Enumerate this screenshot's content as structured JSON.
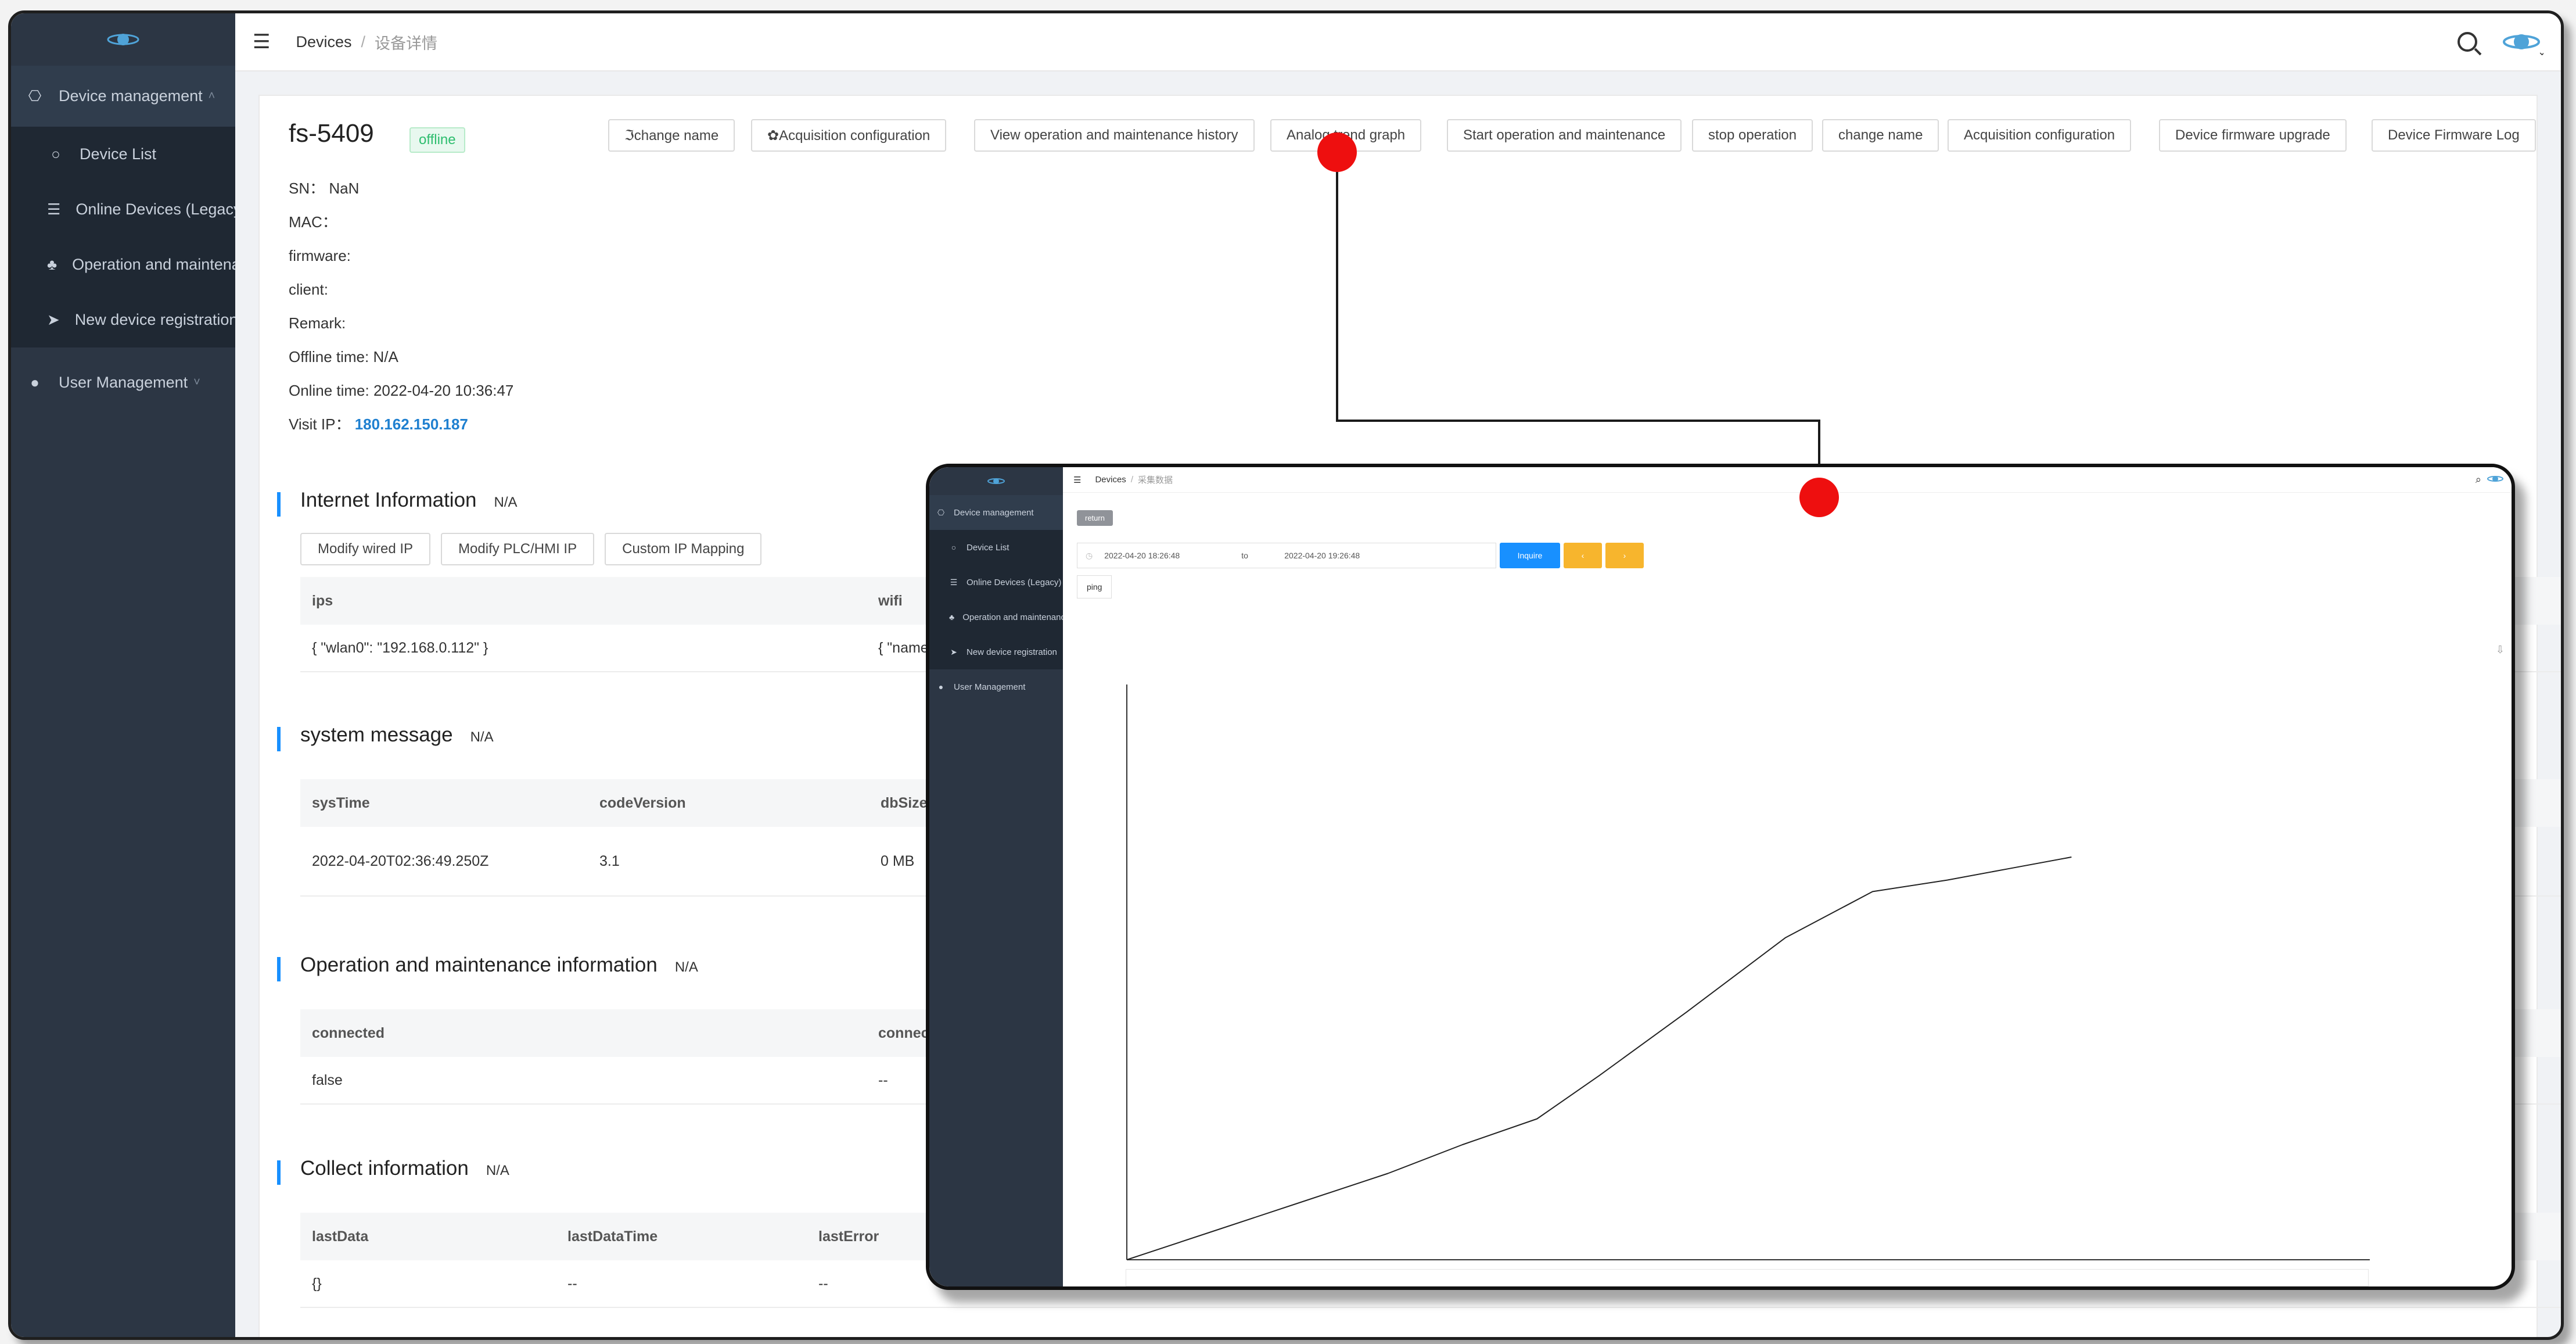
{
  "sidebar": {
    "group_label": "Device management",
    "items": [
      {
        "label": "Device List",
        "icon": "circle-icon"
      },
      {
        "label": "Online Devices (Legacy)",
        "icon": "list-icon"
      },
      {
        "label": "Operation and maintenance",
        "icon": "sitemap-icon"
      },
      {
        "label": "New device registration",
        "icon": "send-icon"
      }
    ],
    "user_label": "User Management"
  },
  "header": {
    "crumb_root": "Devices",
    "crumb_current": "设备详情"
  },
  "device": {
    "name": "fs-5409",
    "status": "offline",
    "sn": "SN：  NaN",
    "mac": "MAC：",
    "firmware": "firmware:",
    "client": "client:",
    "remark": "Remark:",
    "offline_time": "Offline time: N/A",
    "online_time": "Online time: 2022-04-20 10:36:47",
    "visit_ip_label": "Visit IP：",
    "visit_ip": "180.162.150.187"
  },
  "actions": [
    "ℑchange name",
    "✿Acquisition configuration",
    "View operation and maintenance history",
    "Analog trend graph",
    "Start operation and maintenance",
    "stop operation",
    "change name",
    "Acquisition configuration",
    "Device firmware upgrade",
    "Device Firmware Log"
  ],
  "internet": {
    "title": "Internet Information",
    "na": "N/A",
    "buttons": [
      "Modify wired IP",
      "Modify PLC/HMI IP",
      "Custom IP Mapping"
    ],
    "headers": [
      "ips",
      "wifi"
    ],
    "row": [
      "{ \"wlan0\": \"192.168.0.112\" }",
      "{ \"name\":"
    ]
  },
  "system": {
    "title": "system message",
    "na": "N/A",
    "headers": [
      "sysTime",
      "codeVersion",
      "dbSize"
    ],
    "row": [
      "2022-04-20T02:36:49.250Z",
      "3.1",
      "0 MB"
    ]
  },
  "ops": {
    "title": "Operation and maintenance information",
    "na": "N/A",
    "headers": [
      "connected",
      "connectT"
    ],
    "row": [
      "false",
      "--"
    ]
  },
  "collect": {
    "title": "Collect information",
    "na": "N/A",
    "headers": [
      "lastData",
      "lastDataTime",
      "lastError"
    ],
    "row": [
      "{}",
      "--",
      "--"
    ]
  },
  "inset": {
    "crumb_root": "Devices",
    "crumb_current": "采集数据",
    "return_label": "return",
    "start_time": "2022-04-20 18:26:48",
    "to_label": "to",
    "end_time": "2022-04-20 19:26:48",
    "inquire_label": "Inquire",
    "prev_label": "‹",
    "next_label": "›",
    "ping_label": "ping"
  },
  "chart_data": {
    "type": "line",
    "title": "",
    "xlabel": "",
    "ylabel": "",
    "series": [
      {
        "values": [
          0,
          0.05,
          0.1,
          0.15,
          0.2,
          0.245,
          0.32,
          0.43,
          0.56,
          0.64,
          0.66,
          0.68,
          0.7
        ]
      }
    ],
    "x": [
      0,
      0.07,
      0.14,
      0.21,
      0.27,
      0.33,
      0.38,
      0.45,
      0.53,
      0.6,
      0.66,
      0.71,
      0.76
    ],
    "grid": false
  },
  "colors": {
    "sidebar_bg": "#2c3644",
    "accent": "#1890ff",
    "annotation": "#ee0f0f",
    "warning": "#f7b52d",
    "status_green": "#2dbd6e"
  }
}
